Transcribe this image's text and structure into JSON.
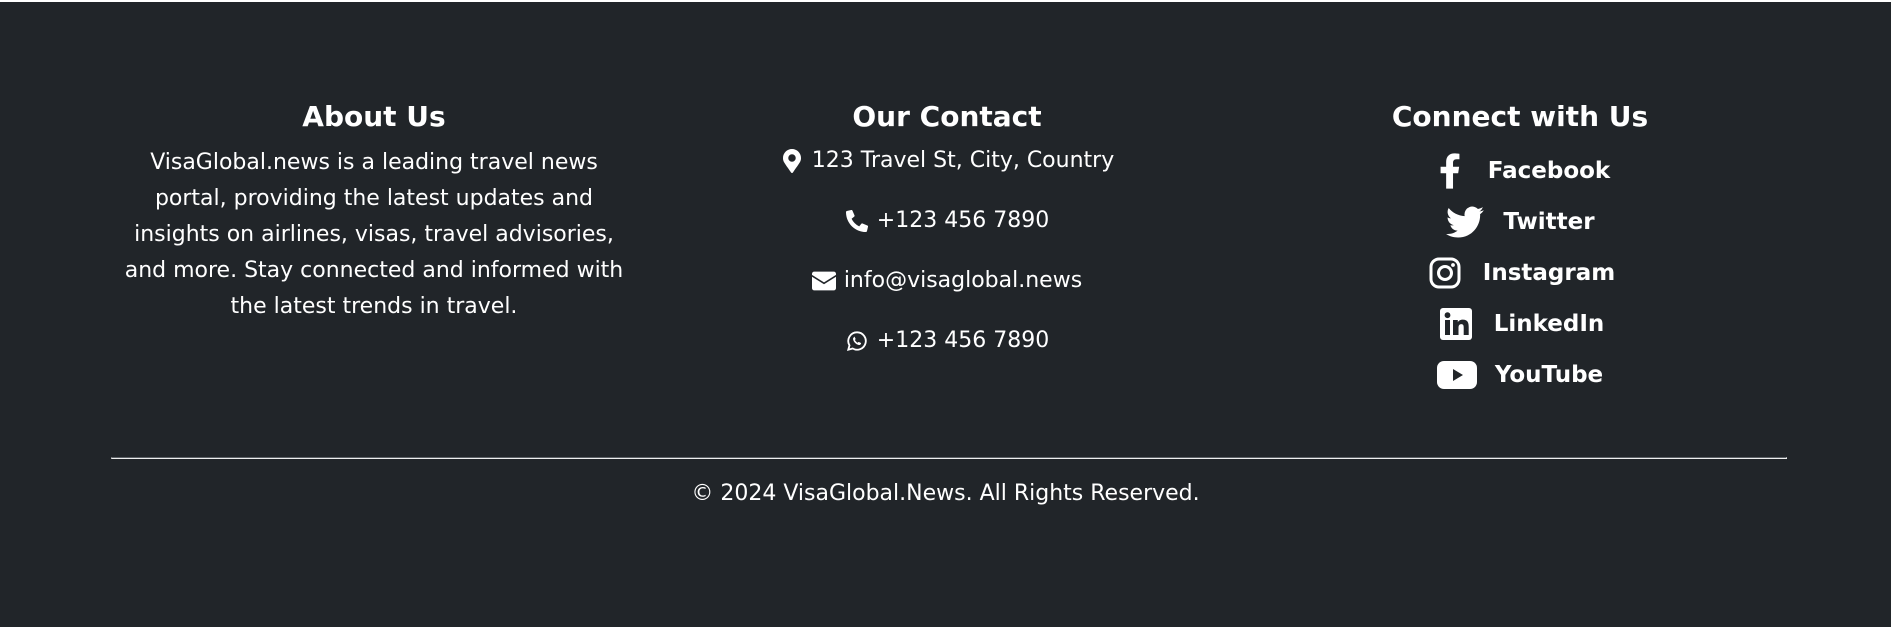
{
  "about": {
    "heading": "About Us",
    "text": "VisaGlobal.news is a leading travel news portal, providing the latest updates and insights on airlines, visas, travel advisories, and more. Stay connected and informed with the latest trends in travel."
  },
  "contact": {
    "heading": "Our Contact",
    "items": [
      {
        "icon": "map-marker-icon",
        "label": "123 Travel St, City, Country"
      },
      {
        "icon": "phone-icon",
        "label": "+123 456 7890"
      },
      {
        "icon": "envelope-icon",
        "label": "info@visaglobal.news"
      },
      {
        "icon": "whatsapp-icon",
        "label": "+123 456 7890"
      }
    ]
  },
  "social": {
    "heading": "Connect with Us",
    "links": [
      {
        "icon": "facebook-icon",
        "label": "Facebook"
      },
      {
        "icon": "twitter-icon",
        "label": "Twitter"
      },
      {
        "icon": "instagram-icon",
        "label": "Instagram"
      },
      {
        "icon": "linkedin-icon",
        "label": "LinkedIn"
      },
      {
        "icon": "youtube-icon",
        "label": "YouTube"
      }
    ]
  },
  "footer": {
    "copyright": "© 2024 VisaGlobal.News. All Rights Reserved."
  },
  "colors": {
    "background": "#212529",
    "text": "#ffffff",
    "divider": "#5c6166"
  }
}
